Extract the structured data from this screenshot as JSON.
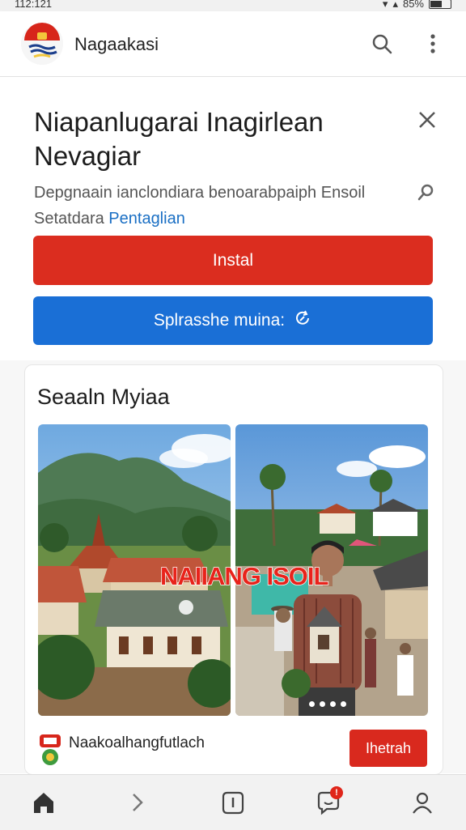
{
  "status_bar": {
    "time": "112:121",
    "battery": "85%"
  },
  "app_bar": {
    "title": "Nagaakasi",
    "icons": [
      "app-logo",
      "search-icon",
      "more-vert-icon"
    ]
  },
  "hero": {
    "headline": "Niapanlugarai Inagirlean Nevagiar",
    "description_prefix": "Depgnaain ianclondiara benoarabpaiph Ensoil Setatdara",
    "description_link": "Pentaglian",
    "install_label": "Instal",
    "secondary_label": "Splrasshe muina:"
  },
  "section": {
    "title": "Seaaln Myiaa",
    "photo_overlay_text": "NAIIANG ISOIL",
    "footer_label": "Naakoalhangfutlach",
    "footer_button": "Ihetrah"
  },
  "bottom_nav": {
    "items": [
      "home-icon",
      "chevron-right-icon",
      "info-icon",
      "chat-icon",
      "profile-icon"
    ],
    "chat_badge": "!"
  },
  "colors": {
    "install": "#db2d1f",
    "secondary": "#1a6fd6",
    "link": "#1a6fc4",
    "overlay_text": "#e8231b"
  }
}
